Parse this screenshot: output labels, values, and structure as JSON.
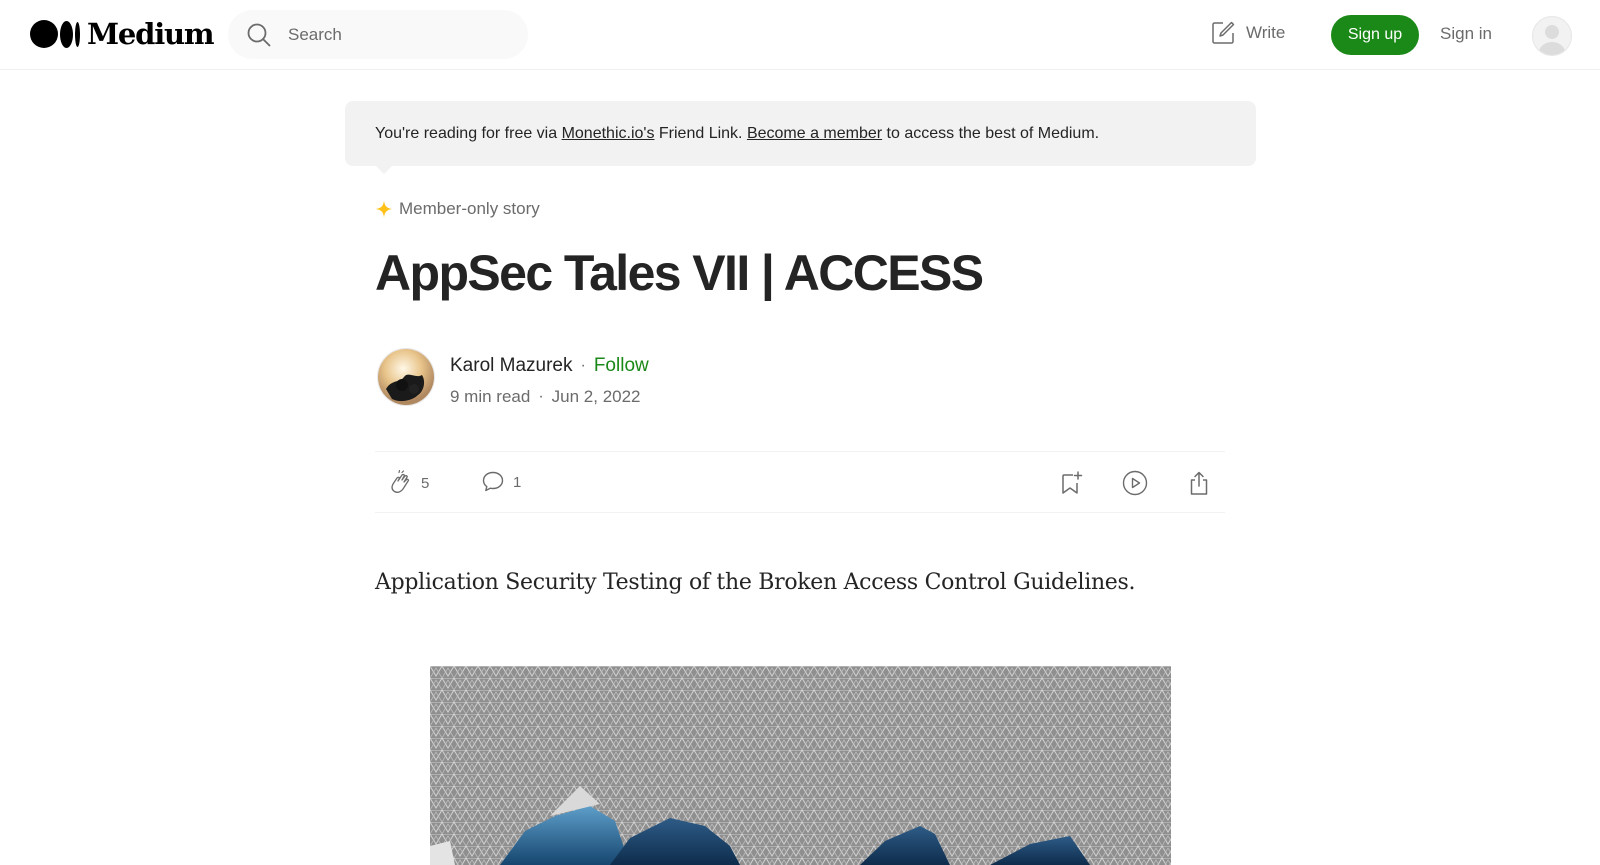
{
  "header": {
    "logo_text": "Medium",
    "search_placeholder": "Search",
    "write_label": "Write",
    "signup_label": "Sign up",
    "signin_label": "Sign in"
  },
  "banner": {
    "prefix": "You're reading for free via ",
    "link1": "Monethic.io's",
    "middle": " Friend Link. ",
    "link2": "Become a member",
    "suffix": " to access the best of Medium."
  },
  "article": {
    "member_label": "Member-only story",
    "title": "AppSec Tales VII | ACCESS",
    "author": "Karol Mazurek",
    "separator": "·",
    "follow_label": "Follow",
    "read_time": "9 min read",
    "date": "Jun 2, 2022",
    "claps": "5",
    "responses": "1",
    "subtitle": "Application Security Testing of the Broken Access Control Guidelines."
  },
  "colors": {
    "accent_green": "#1a8917",
    "member_star": "#ffc017",
    "banner_bg": "#f2f2f2"
  },
  "icons": [
    "search-icon",
    "write-icon",
    "user-icon",
    "star-icon",
    "clap-icon",
    "comment-icon",
    "bookmark-add-icon",
    "play-icon",
    "share-icon"
  ]
}
